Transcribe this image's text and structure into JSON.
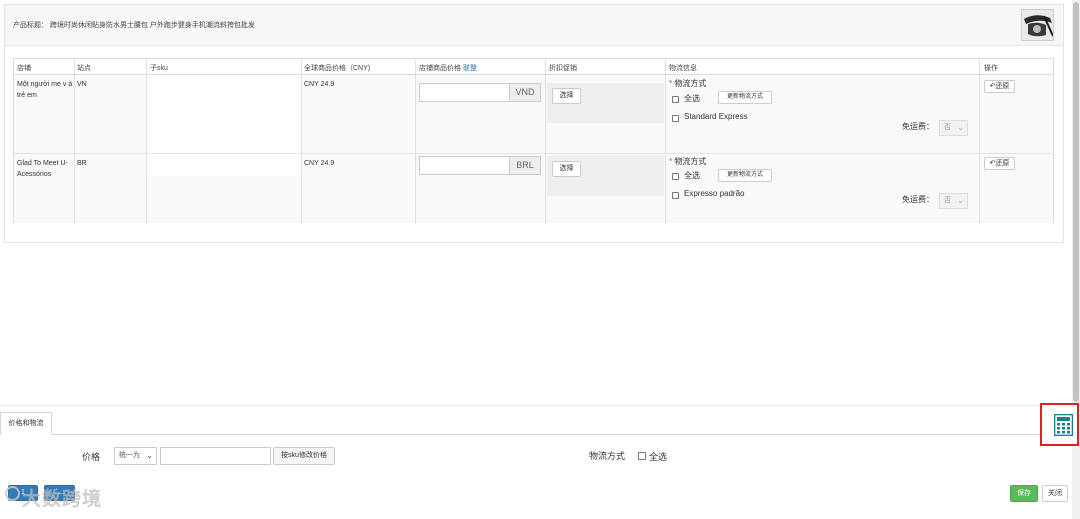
{
  "header": {
    "title_label": "产品标题：",
    "title_text": "跨境时尚休闲贴身防水男士腰包 户外跑步健身手机潮流斜挎包批发"
  },
  "table": {
    "columns": [
      "店铺",
      "站点",
      "子sku",
      "全球商品价格（CNY)",
      "店铺商品价格",
      "折扣促销",
      "物流信息",
      "操作"
    ],
    "batch_link": "联整",
    "rows": [
      {
        "shop": "Một người mẹ v à trẻ em",
        "site": "VN",
        "global_price": "CNY 24.9",
        "price_value": "",
        "currency": "VND",
        "discount_button": "选择",
        "shipping_label": "物流方式",
        "select_all": "全选",
        "update_button": "更新物流方式",
        "shipping_option": "Standard Express",
        "free_shipping_label": "免运费：",
        "free_shipping_value": "否",
        "action_button": "还原"
      },
      {
        "shop": "Glad To Meet U- Acessórios",
        "site": "BR",
        "global_price": "CNY 24.9",
        "price_value": "",
        "currency": "BRL",
        "discount_button": "选择",
        "shipping_label": "物流方式",
        "select_all": "全选",
        "update_button": "更新物流方式",
        "shipping_option": "Expresso padrão",
        "free_shipping_label": "免运费：",
        "free_shipping_value": "否",
        "action_button": "还原"
      }
    ]
  },
  "bottom": {
    "tab_label": "价格和物流",
    "price_label": "价格",
    "price_mode": "统一为",
    "price_value": "",
    "sku_price_button": "按sku修改价格",
    "shipping_label": "物流方式",
    "select_all": "全选",
    "left_button_1": "1",
    "left_button_2": "ʻ..."
  },
  "watermark": "大数跨境",
  "footer": {
    "save": "保存",
    "close": "关闭"
  },
  "icons": {
    "calculator": "calculator-icon",
    "undo": "undo-icon"
  },
  "colors": {
    "primary": "#337ab7",
    "save": "#5cb85c",
    "highlight": "#e02020",
    "calculator": "#1a7f8a"
  }
}
